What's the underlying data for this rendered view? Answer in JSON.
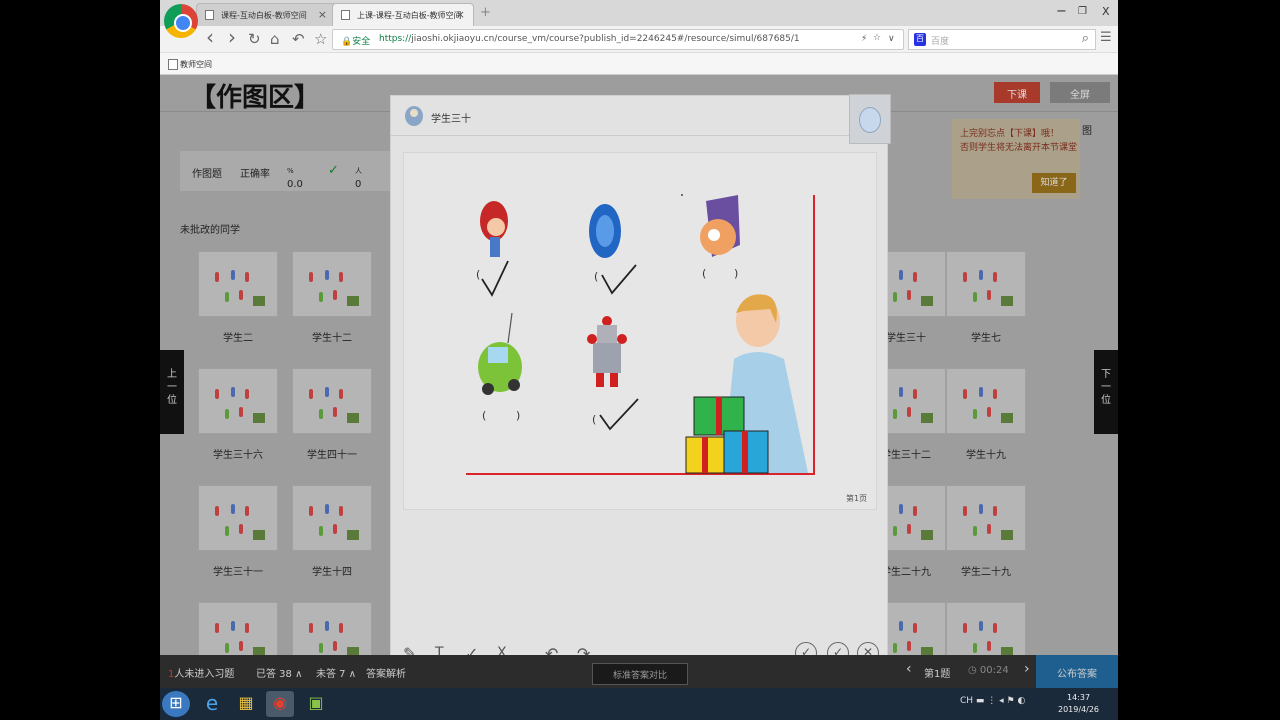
{
  "browser": {
    "tabs": [
      {
        "title": "课程-互动白板-教师空间",
        "active": false
      },
      {
        "title": "上课-课程-互动白板-教师空间",
        "active": true
      }
    ],
    "new_tab": "+",
    "window": {
      "minimize": "−",
      "restore": "❐",
      "close": "X"
    },
    "nav": {
      "back": "‹",
      "forward": "›",
      "reload": "↻",
      "home": "⌂",
      "undo": "↶",
      "star": "☆"
    },
    "secure_label": "安全",
    "url_scheme": "https://",
    "url_host": "jiaoshi.okjiaoyu.cn",
    "url_path": "/course_vm/course?publish_id=2246245#/resource/simul/687685/1",
    "addr_icons": {
      "bolt": "⚡",
      "star": "☆",
      "chevron": "∨"
    },
    "search_engine_icon": "百",
    "search_placeholder": "百度",
    "search_icon": "⌕",
    "menu_icon": "☰",
    "bookmark": "教师空间"
  },
  "page": {
    "title": "【作图区】",
    "btn_xiake": "下课",
    "btn_fullscreen": "全屏",
    "side_text": "图",
    "stats": {
      "type": "作图题",
      "rate_label": "正确率",
      "rate_value": "0.0",
      "rate_unit": "%",
      "check": "✓",
      "count_value": "0",
      "count_unit": "人"
    },
    "section_label": "未批改的同学",
    "notice": {
      "line1": "上完别忘点【下课】哦！",
      "line2": "否则学生将无法离开本节课堂",
      "button": "知道了"
    },
    "prev_button": "上一位",
    "next_button": "下一位",
    "students_left": [
      [
        "学生二",
        "学生十二"
      ],
      [
        "学生三十六",
        "学生四十一"
      ],
      [
        "学生三十一",
        "学生十四"
      ],
      [
        "",
        ""
      ]
    ],
    "students_right": [
      [
        "学生三十",
        "学生七"
      ],
      [
        "学生三十二",
        "学生十九"
      ],
      [
        "学生二十九",
        "学生二十九"
      ],
      [
        "",
        ""
      ]
    ]
  },
  "modal": {
    "student_name": "学生三十",
    "page_no": "第1页",
    "marks": {
      "paren_open": "(",
      "paren_close": ")",
      "tick": "✓"
    },
    "tools": {
      "pen": "✎",
      "text": "T",
      "check": "✓",
      "cross": "X",
      "undo": "↶",
      "redo": "↷"
    },
    "grade": {
      "right": "✓",
      "half": "✓",
      "wrong": "✕"
    }
  },
  "bottombar": {
    "not_joined": "人未进入习题",
    "answered": "已答 38",
    "answered_arrow": "∧",
    "unanswered": "未答 7",
    "unanswered_arrow": "∧",
    "answer_analysis": "答案解析",
    "center_btn": "标准答案对比",
    "question_no": "第1题",
    "timer": "00:24",
    "publish": "公布答案",
    "prev_arrow": "‹",
    "next_arrow": "›"
  },
  "taskbar": {
    "start": "⊞",
    "ie": "e",
    "explorer": "▦",
    "chrome": "◉",
    "app": "▣",
    "tray": "CH ▬ ⋮ ◂ ⚑ ◐",
    "time": "14:37",
    "date": "2019/4/26"
  },
  "colors": {
    "red_axis": "#d8242a",
    "publish": "#1f5f8f",
    "xiake": "#a83a2c"
  }
}
